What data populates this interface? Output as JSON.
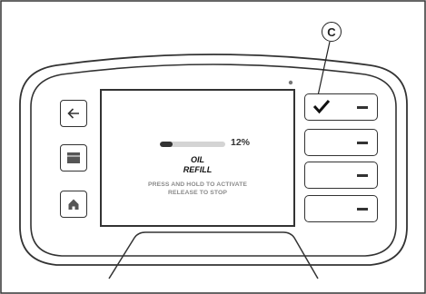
{
  "callout": {
    "label": "C"
  },
  "side_buttons": [
    {
      "icon": "back-arrow-icon"
    },
    {
      "icon": "menu-icon"
    },
    {
      "icon": "home-icon"
    }
  ],
  "soft_keys": [
    {
      "icon": "checkmark-icon"
    },
    {
      "icon": "dash-icon"
    },
    {
      "icon": "dash-icon"
    },
    {
      "icon": "dash-icon"
    }
  ],
  "screen": {
    "progress_fraction": 0.12,
    "progress_text": "12%",
    "title_line1": "OIL",
    "title_line2": "REFILL",
    "instruction_line1": "PRESS AND HOLD TO ACTIVATE",
    "instruction_line2": "RELEASE TO STOP"
  },
  "colors": {
    "outline": "#333333",
    "progress_track": "#d4d4d4",
    "instruction_text": "#8a8a8a"
  }
}
